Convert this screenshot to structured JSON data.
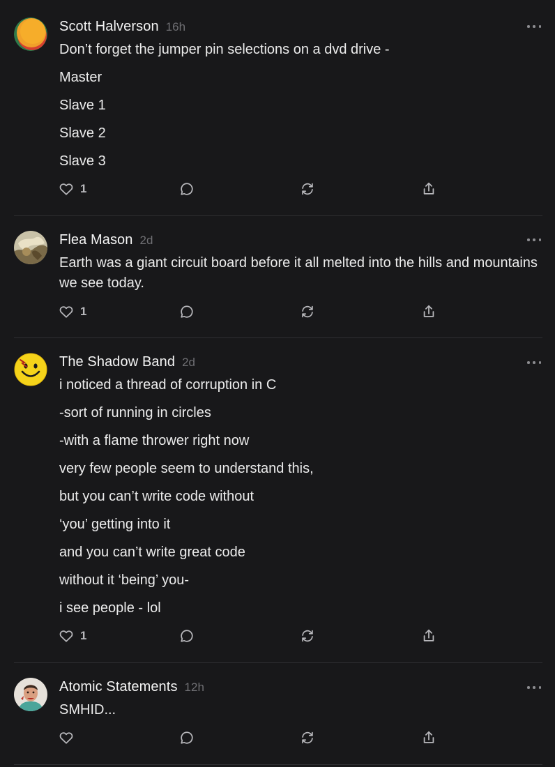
{
  "posts": [
    {
      "author": "Scott Halverson",
      "time": "16h",
      "avatar_icon": "orange-circle-avatar-icon",
      "lines": [
        "Don’t forget the jumper pin selections on a dvd drive -",
        "Master",
        "Slave 1",
        "Slave 2",
        "Slave 3"
      ],
      "likes": "1"
    },
    {
      "author": "Flea Mason",
      "time": "2d",
      "avatar_icon": "photo-avatar-icon",
      "lines": [
        "Earth was a giant circuit board before it all melted into the hills and mountains we see today."
      ],
      "likes": "1"
    },
    {
      "author": "The Shadow Band",
      "time": "2d",
      "avatar_icon": "smiley-face-avatar-icon",
      "lines": [
        "i noticed a thread of corruption in C",
        "-sort of running in circles",
        "-with a flame thrower right now",
        "very few people seem to understand this,",
        "but you can’t write code without",
        "‘you’ getting into it",
        "and you can’t write great code",
        "without it ‘being’ you-",
        "i see people - lol"
      ],
      "likes": "1"
    },
    {
      "author": "Atomic Statements",
      "time": "12h",
      "avatar_icon": "person-photo-avatar-icon",
      "lines": [
        "SMHID..."
      ],
      "likes": ""
    }
  ],
  "icons": {
    "like": "heart-icon",
    "comment": "comment-bubble-icon",
    "restack": "restack-arrows-icon",
    "share": "share-upload-icon",
    "more": "more-dots-icon"
  },
  "colors": {
    "background": "#18181a",
    "divider": "#2f2f32",
    "text": "#ececec",
    "muted": "#6f6f73",
    "icon": "#b8b8bc"
  }
}
